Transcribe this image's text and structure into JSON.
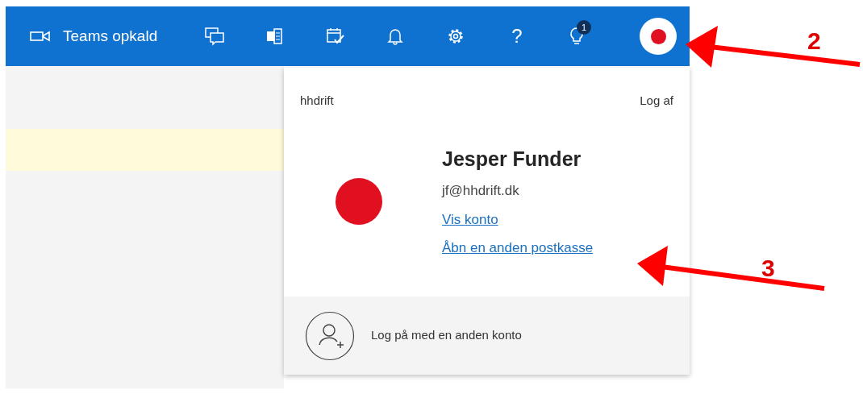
{
  "top_bar": {
    "items": [
      {
        "kind": "teams",
        "label": "Teams opkald"
      },
      {
        "kind": "chat"
      },
      {
        "kind": "office"
      },
      {
        "kind": "calendar"
      },
      {
        "kind": "bell"
      },
      {
        "kind": "settings"
      },
      {
        "kind": "help",
        "label": "?"
      },
      {
        "kind": "tips",
        "badge": "1"
      },
      {
        "kind": "avatar"
      }
    ]
  },
  "account_panel": {
    "organization": "hhdrift",
    "sign_out": "Log af",
    "name": "Jesper Funder",
    "email": "jf@hhdrift.dk",
    "links": [
      "Vis konto",
      "Åbn en anden postkasse"
    ],
    "other_account": "Log på med en anden konto"
  },
  "annotations": [
    {
      "number": "2"
    },
    {
      "number": "3"
    }
  ]
}
